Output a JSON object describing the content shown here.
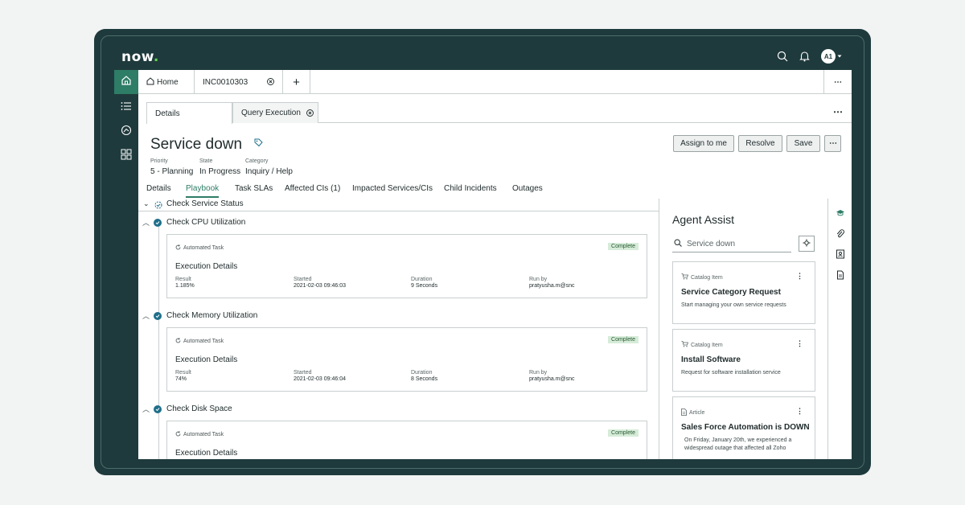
{
  "brand": {
    "logo_text": "now",
    "logo_dot": "."
  },
  "header": {
    "user_initials": "A1"
  },
  "tabs": {
    "home": "Home",
    "incident": "INC0010303",
    "add": "+",
    "more": "⋯"
  },
  "subtabs": {
    "details": "Details",
    "query": "Query Execution",
    "more": "⋯"
  },
  "record": {
    "title": "Service down",
    "fields": [
      {
        "label": "Priority",
        "value": "5 - Planning"
      },
      {
        "label": "State",
        "value": "In Progress"
      },
      {
        "label": "Category",
        "value": "Inquiry / Help"
      }
    ]
  },
  "actions": {
    "assign": "Assign to me",
    "resolve": "Resolve",
    "save": "Save",
    "more": "⋯"
  },
  "record_tabs": [
    "Details",
    "Playbook",
    "Task SLAs",
    "Affected CIs (1)",
    "Impacted Services/CIs",
    "Child Incidents",
    "Outages"
  ],
  "playbook": {
    "header": "Check Service Status",
    "steps": [
      {
        "name": "Check CPU Utilization",
        "task_type": "Automated Task",
        "status": "Complete",
        "exec_title": "Execution Details",
        "result_label": "Result",
        "result": "1.185%",
        "started_label": "Started",
        "started": "2021-02-03 09:46:03",
        "duration_label": "Duration",
        "duration": "9 Seconds",
        "runby_label": "Run by",
        "runby": "pratyusha.m@snc"
      },
      {
        "name": "Check Memory Utilization",
        "task_type": "Automated Task",
        "status": "Complete",
        "exec_title": "Execution Details",
        "result_label": "Result",
        "result": "74%",
        "started_label": "Started",
        "started": "2021-02-03 09:46:04",
        "duration_label": "Duration",
        "duration": "8 Seconds",
        "runby_label": "Run by",
        "runby": "pratyusha.m@snc"
      },
      {
        "name": "Check Disk Space",
        "task_type": "Automated Task",
        "status": "Complete",
        "exec_title": "Execution Details"
      }
    ]
  },
  "assist": {
    "title": "Agent Assist",
    "search_value": "Service down",
    "cards": [
      {
        "type": "Catalog Item",
        "name": "Service Category Request",
        "desc": "Start managing your own service requests"
      },
      {
        "type": "Catalog Item",
        "name": "Install Software",
        "desc": "Request for software installation service"
      },
      {
        "type": "Article",
        "name": "Sales Force Automation is DOWN",
        "desc": "On Friday, January 20th, we experienced a widespread outage that affected all Zoho"
      }
    ]
  },
  "colors": {
    "frame": "#1f3a3c",
    "accent": "#2e7d66",
    "check": "#1f6f8b",
    "badge_bg": "#d6ecd9"
  }
}
